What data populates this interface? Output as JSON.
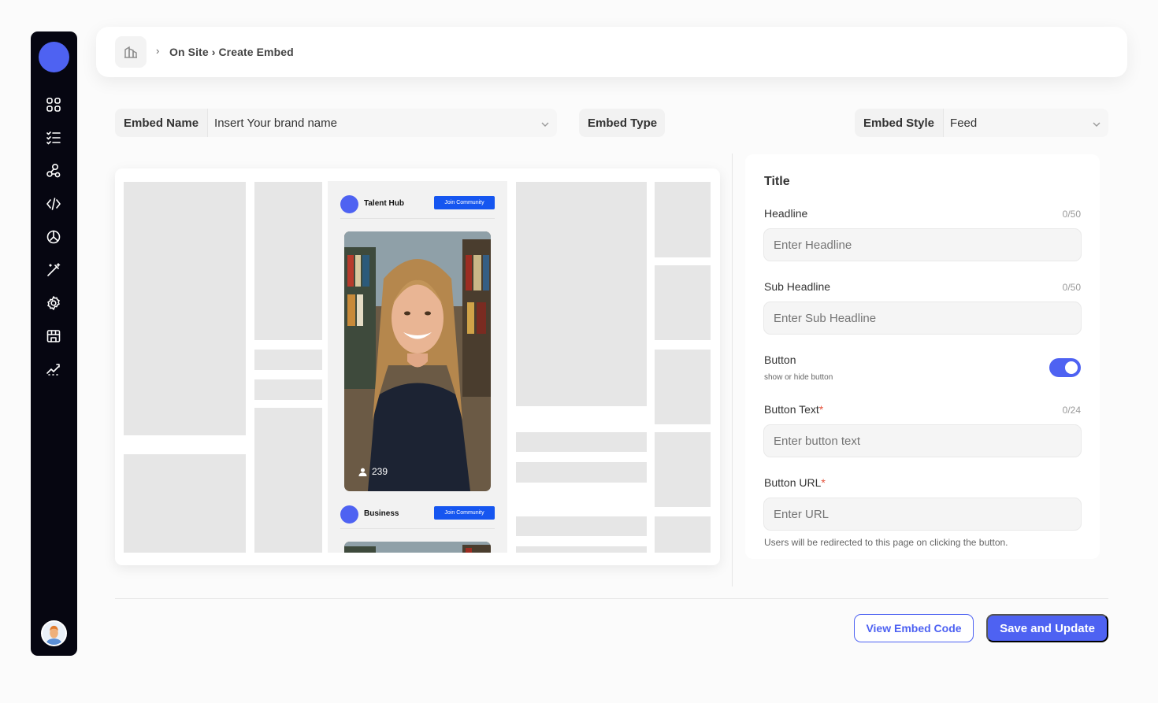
{
  "sidebar": {
    "items": [
      {
        "icon": "dashboard-grid-icon"
      },
      {
        "icon": "checklist-icon"
      },
      {
        "icon": "network-nodes-icon"
      },
      {
        "icon": "code-icon"
      },
      {
        "icon": "analytics-pie-icon"
      },
      {
        "icon": "magic-wand-icon"
      },
      {
        "icon": "settings-gear-icon"
      },
      {
        "icon": "storefront-icon"
      },
      {
        "icon": "trend-chart-icon"
      }
    ]
  },
  "header": {
    "breadcrumb_separator": "›",
    "breadcrumb": "On Site › Create Embed"
  },
  "settings": {
    "embed_name_label": "Embed  Name",
    "embed_name_value": "Insert Your brand name",
    "embed_type_label": "Embed Type",
    "embed_style_label": "Embed Style",
    "embed_style_value": "Feed"
  },
  "preview": {
    "posts": [
      {
        "name": "Talent Hub",
        "button": "Join Community",
        "count": "239"
      },
      {
        "name": "Business",
        "button": "Join Community"
      }
    ]
  },
  "form": {
    "title": "Title",
    "headline_label": "Headline",
    "headline_count": "0/50",
    "headline_placeholder": "Enter Headline",
    "subheadline_label": "Sub Headline",
    "subheadline_count": "0/50",
    "subheadline_placeholder": "Enter Sub Headline",
    "button_label": "Button",
    "button_sub": "show or hide button",
    "button_toggle_on": true,
    "button_text_label": "Button Text",
    "button_text_count": "0/24",
    "button_text_placeholder": "Enter button text",
    "button_url_label": "Button URL",
    "button_url_placeholder": "Enter URL",
    "required_mark": "*",
    "help_text": "Users will be redirected to this page on clicking the button."
  },
  "actions": {
    "view_code": "View Embed Code",
    "save": "Save and Update"
  },
  "colors": {
    "accent": "#4e62f2",
    "join_button": "#1656f0",
    "sidebar_bg": "#060611"
  }
}
